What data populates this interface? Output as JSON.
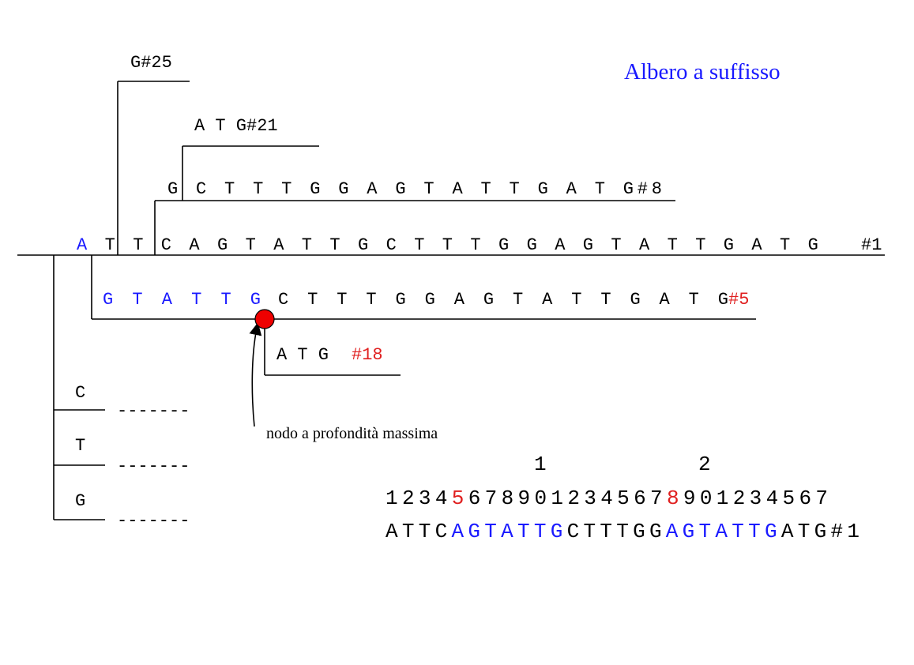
{
  "title": "Albero a suffisso",
  "note_label": "nodo a profondità massima",
  "colors": {
    "highlight": "#1a1aff",
    "leaf_number": "#e02020",
    "text": "#000000",
    "node": "#ee0000"
  },
  "tree": {
    "main_path": {
      "chars": [
        "A",
        "T",
        "T",
        "C",
        "A",
        "G",
        "T",
        "A",
        "T",
        "T",
        "G",
        "C",
        "T",
        "T",
        "T",
        "G",
        "G",
        "A",
        "G",
        "T",
        "A",
        "T",
        "T",
        "G",
        "A",
        "T",
        "G"
      ],
      "leaf": "#1"
    },
    "branch_g25": {
      "text": "G#25"
    },
    "branch_atg21": {
      "text": "A T G#21"
    },
    "branch_g8": {
      "first": "G",
      "rest": "C T T T G G A G T A T T G A T G#8"
    },
    "branch_5": {
      "prefix": "G T A T T G",
      "suffix": "C T T T G G A G T A T T G A T G",
      "leaf": "#5"
    },
    "branch_18": {
      "text": "A T G",
      "leaf": "#18"
    },
    "root_branches": [
      {
        "label": "C",
        "dashes": "-------"
      },
      {
        "label": "T",
        "dashes": "-------"
      },
      {
        "label": "G",
        "dashes": "-------"
      }
    ]
  },
  "string_index": {
    "tens": [
      "1",
      "2"
    ],
    "positions": {
      "a": "1234",
      "b": "5",
      "c": "67890123456",
      "d": "7",
      "e": "8",
      "f": "901234567"
    },
    "sequence": {
      "a": "ATTC",
      "b": "AGTATTG",
      "c": "CTTTGG",
      "d": "AGTATTG",
      "e": "ATG#1"
    }
  }
}
